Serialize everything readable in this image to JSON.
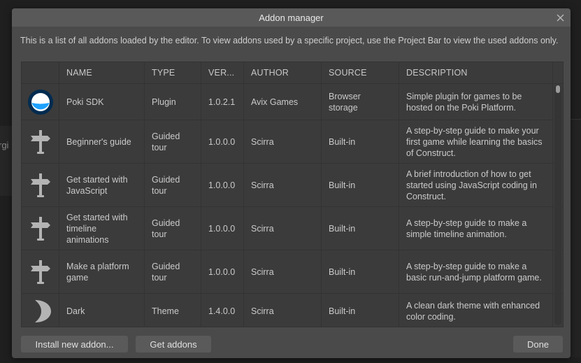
{
  "background": {
    "partial_text": "rgi"
  },
  "dialog": {
    "title": "Addon manager",
    "close_icon": "close-icon",
    "intro": "This is a list of all addons loaded by the editor. To view addons used by a specific project, use the Project Bar to view the used addons only."
  },
  "table": {
    "columns": [
      "",
      "NAME",
      "TYPE",
      "VER...",
      "AUTHOR",
      "SOURCE",
      "DESCRIPTION"
    ],
    "rows": [
      {
        "icon": "poki-logo-icon",
        "name": "Poki SDK",
        "type": "Plugin",
        "version": "1.0.2.1",
        "author": "Avix Games",
        "source": "Browser storage",
        "description": "Simple plugin for games to be hosted on the Poki Platform."
      },
      {
        "icon": "signpost-icon",
        "name": "Beginner's guide",
        "type": "Guided tour",
        "version": "1.0.0.0",
        "author": "Scirra",
        "source": "Built-in",
        "description": "A step-by-step guide to make your first game while learning the basics of Construct."
      },
      {
        "icon": "signpost-icon",
        "name": "Get started with JavaScript",
        "type": "Guided tour",
        "version": "1.0.0.0",
        "author": "Scirra",
        "source": "Built-in",
        "description": "A brief introduction of how to get started using JavaScript coding in Construct."
      },
      {
        "icon": "signpost-icon",
        "name": "Get started with timeline animations",
        "type": "Guided tour",
        "version": "1.0.0.0",
        "author": "Scirra",
        "source": "Built-in",
        "description": "A step-by-step guide to make a simple timeline animation."
      },
      {
        "icon": "signpost-icon",
        "name": "Make a platform game",
        "type": "Guided tour",
        "version": "1.0.0.0",
        "author": "Scirra",
        "source": "Built-in",
        "description": "A step-by-step guide to make a basic run-and-jump platform game."
      },
      {
        "icon": "moon-icon",
        "name": "Dark",
        "type": "Theme",
        "version": "1.4.0.0",
        "author": "Scirra",
        "source": "Built-in",
        "description": "A clean dark theme with enhanced color coding."
      }
    ]
  },
  "buttons": {
    "install": "Install new addon...",
    "get": "Get addons",
    "done": "Done"
  },
  "colors": {
    "poki_blue": "#1ea1ff",
    "poki_navy": "#002b50",
    "icon_gray": "#b4b4b4"
  }
}
